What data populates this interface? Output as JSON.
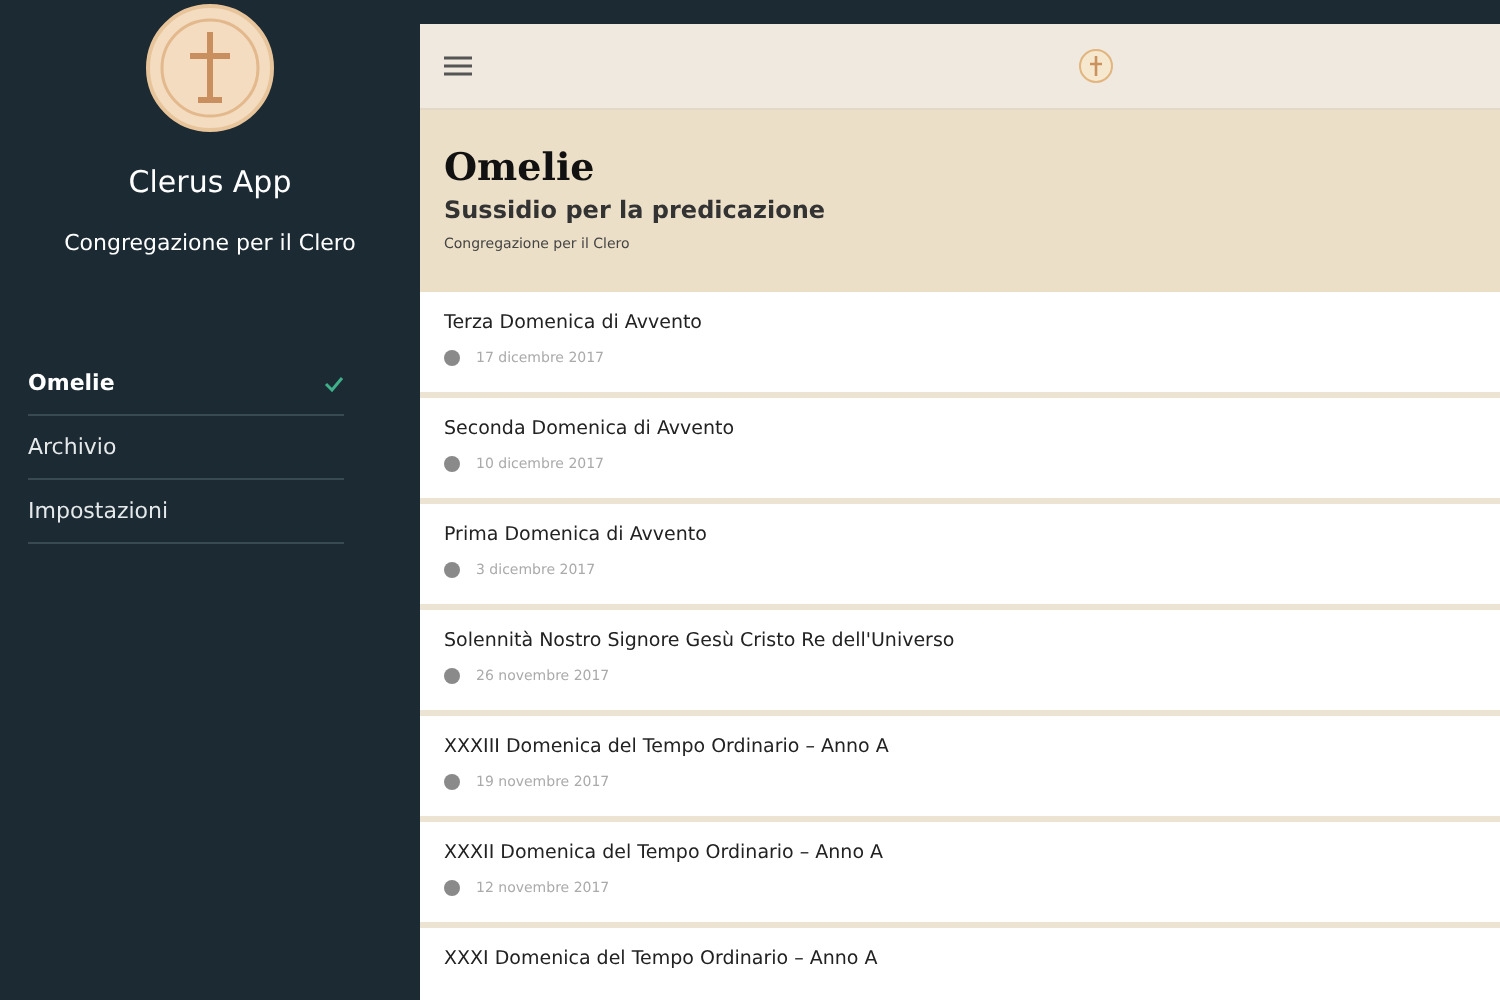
{
  "sidebar": {
    "app_name": "Clerus App",
    "subtitle": "Congregazione per il Clero",
    "items": [
      {
        "label": "Omelie",
        "selected": true
      },
      {
        "label": "Archivio",
        "selected": false
      },
      {
        "label": "Impostazioni",
        "selected": false
      }
    ]
  },
  "header": {
    "title": "Omelie",
    "subtitle": "Sussidio per la predicazione",
    "source": "Congregazione per il Clero"
  },
  "homilies": [
    {
      "title": "Terza Domenica di Avvento",
      "date": "17 dicembre 2017"
    },
    {
      "title": "Seconda Domenica di Avvento",
      "date": "10 dicembre 2017"
    },
    {
      "title": "Prima Domenica di Avvento",
      "date": "3 dicembre 2017"
    },
    {
      "title": "Solennità Nostro Signore Gesù Cristo Re dell'Universo",
      "date": "26 novembre 2017"
    },
    {
      "title": "XXXIII Domenica del Tempo Ordinario – Anno A",
      "date": "19 novembre 2017"
    },
    {
      "title": "XXXII Domenica del Tempo Ordinario – Anno A",
      "date": "12 novembre 2017"
    },
    {
      "title": "XXXI Domenica del Tempo Ordinario – Anno A"
    }
  ]
}
